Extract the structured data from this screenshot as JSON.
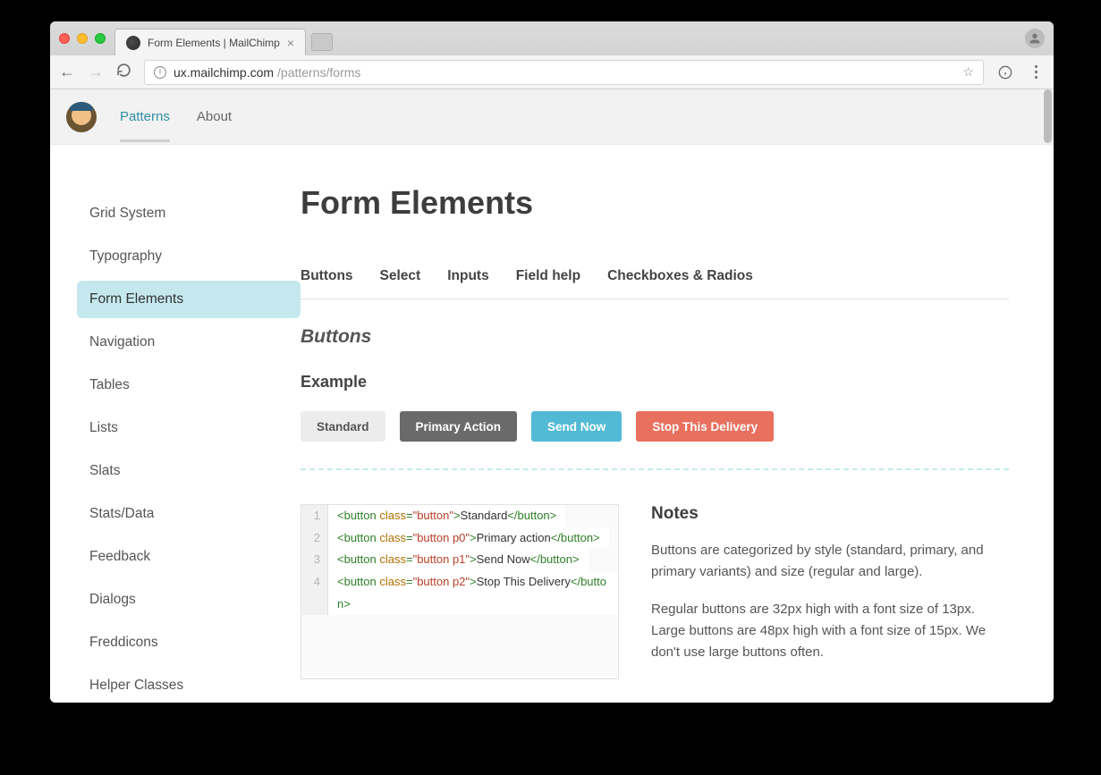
{
  "browser": {
    "tab_title": "Form Elements | MailChimp",
    "url_host": "ux.mailchimp.com",
    "url_path": "/patterns/forms"
  },
  "header": {
    "nav": [
      "Patterns",
      "About"
    ],
    "active_index": 0
  },
  "sidebar": {
    "items": [
      "Grid System",
      "Typography",
      "Form Elements",
      "Navigation",
      "Tables",
      "Lists",
      "Slats",
      "Stats/Data",
      "Feedback",
      "Dialogs",
      "Freddicons",
      "Helper Classes"
    ],
    "active_index": 2
  },
  "main": {
    "page_title": "Form Elements",
    "subnav": [
      "Buttons",
      "Select",
      "Inputs",
      "Field help",
      "Checkboxes & Radios"
    ],
    "section_title": "Buttons",
    "example_heading": "Example",
    "buttons": [
      {
        "label": "Standard",
        "variant": "standard"
      },
      {
        "label": "Primary Action",
        "variant": "p0"
      },
      {
        "label": "Send Now",
        "variant": "p1"
      },
      {
        "label": "Stop This Delivery",
        "variant": "p2"
      }
    ],
    "code_lines": [
      {
        "n": "1",
        "parts": [
          {
            "t": "tag",
            "v": "<button "
          },
          {
            "t": "attr",
            "v": "class"
          },
          {
            "t": "tag",
            "v": "="
          },
          {
            "t": "str",
            "v": "\"button\""
          },
          {
            "t": "tag",
            "v": ">"
          },
          {
            "t": "txt",
            "v": "Standard"
          },
          {
            "t": "tag",
            "v": "</button>"
          }
        ]
      },
      {
        "n": "2",
        "parts": [
          {
            "t": "tag",
            "v": "<button "
          },
          {
            "t": "attr",
            "v": "class"
          },
          {
            "t": "tag",
            "v": "="
          },
          {
            "t": "str",
            "v": "\"button p0\""
          },
          {
            "t": "tag",
            "v": ">"
          },
          {
            "t": "txt",
            "v": "Primary action"
          },
          {
            "t": "tag",
            "v": "</button>"
          }
        ]
      },
      {
        "n": "3",
        "parts": [
          {
            "t": "tag",
            "v": "<button "
          },
          {
            "t": "attr",
            "v": "class"
          },
          {
            "t": "tag",
            "v": "="
          },
          {
            "t": "str",
            "v": "\"button p1\""
          },
          {
            "t": "tag",
            "v": ">"
          },
          {
            "t": "txt",
            "v": "Send Now"
          },
          {
            "t": "tag",
            "v": "</button>"
          }
        ]
      },
      {
        "n": "4",
        "parts": [
          {
            "t": "tag",
            "v": "<button "
          },
          {
            "t": "attr",
            "v": "class"
          },
          {
            "t": "tag",
            "v": "="
          },
          {
            "t": "str",
            "v": "\"button p2\""
          },
          {
            "t": "tag",
            "v": ">"
          },
          {
            "t": "txt",
            "v": "Stop This Delivery"
          },
          {
            "t": "tag",
            "v": "</button>"
          }
        ]
      }
    ],
    "notes": {
      "heading": "Notes",
      "p1": "Buttons are categorized by style (standard, primary, and primary variants) and size (regular and large).",
      "p2": "Regular buttons are 32px high with a font size of 13px. Large buttons are 48px high with a font size of 15px. We don't use large buttons often."
    }
  }
}
